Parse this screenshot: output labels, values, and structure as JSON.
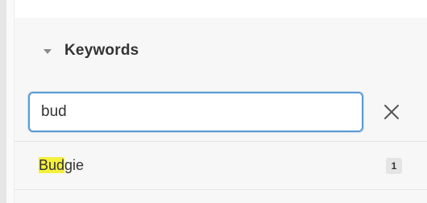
{
  "keywords_section": {
    "title": "Keywords",
    "expanded": true
  },
  "search": {
    "value": "bud"
  },
  "results": [
    {
      "label_highlight": "Bud",
      "label_rest": "gie",
      "count": "1"
    }
  ],
  "colors": {
    "highlight": "#f5f03b",
    "focus_border": "#5b9bd5",
    "panel_background": "#f7f7f7"
  },
  "icons": {
    "collapse": "caret-down-icon",
    "clear": "close-icon"
  }
}
